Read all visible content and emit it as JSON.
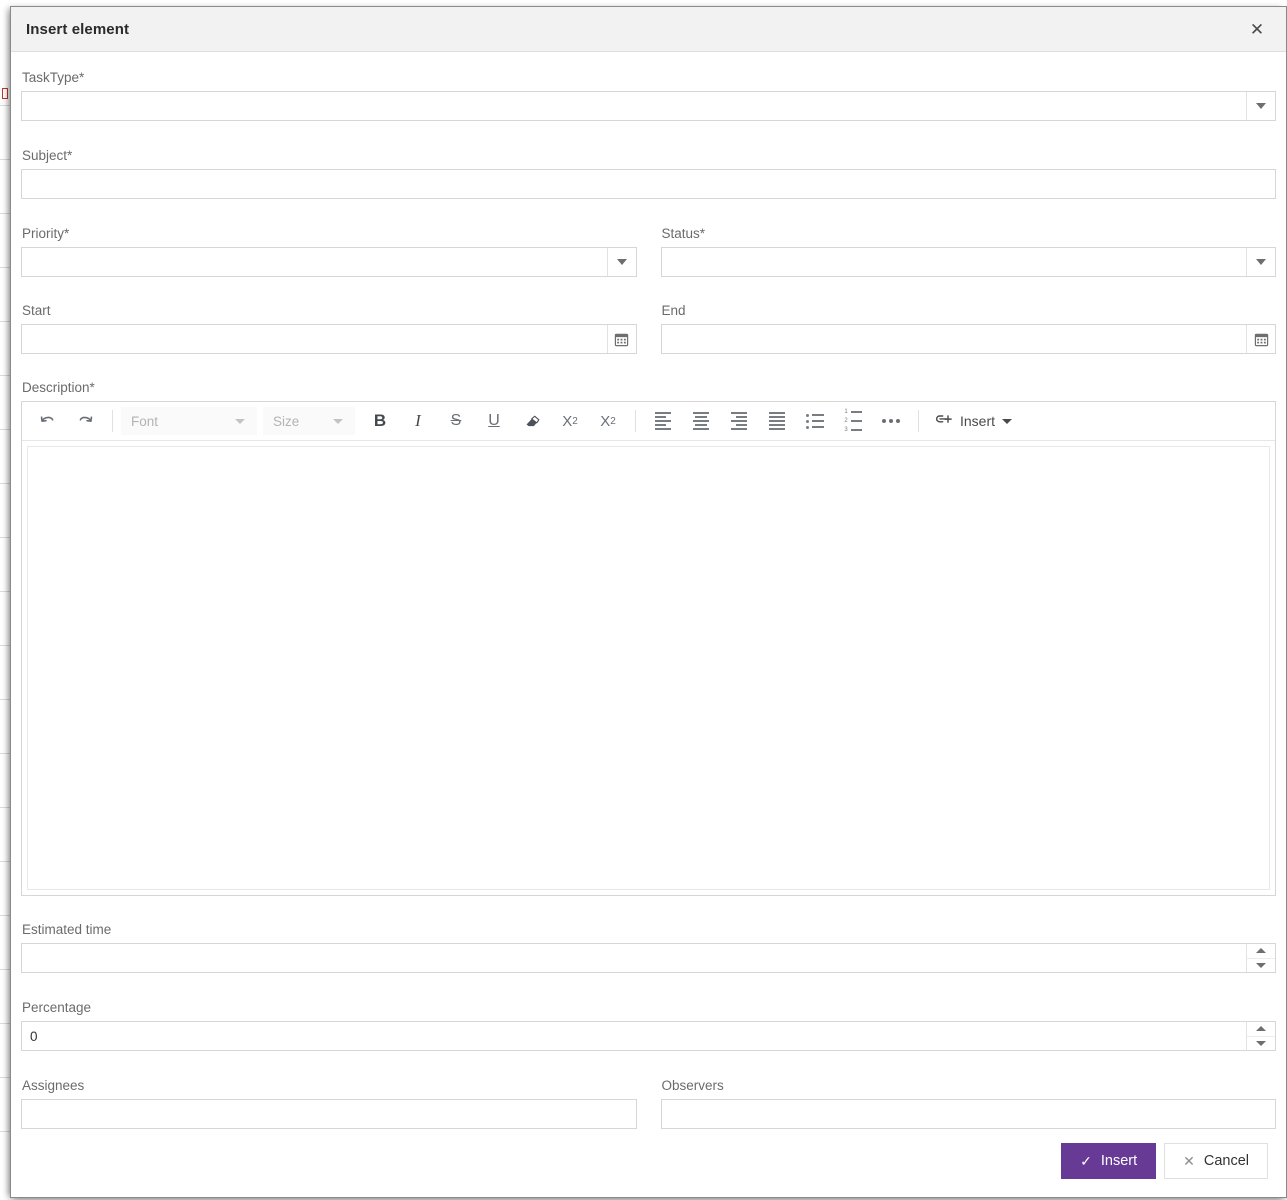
{
  "dialog": {
    "title": "Insert element",
    "close_icon": "close-icon"
  },
  "form": {
    "tasktype": {
      "label": "TaskType*",
      "value": "",
      "placeholder": "",
      "control": "dropdown"
    },
    "subject": {
      "label": "Subject*",
      "value": "",
      "placeholder": "",
      "control": "text"
    },
    "priority": {
      "label": "Priority*",
      "value": "",
      "placeholder": "",
      "control": "dropdown"
    },
    "status": {
      "label": "Status*",
      "value": "",
      "placeholder": "",
      "control": "dropdown"
    },
    "start": {
      "label": "Start",
      "value": "",
      "placeholder": "",
      "control": "datepicker"
    },
    "end": {
      "label": "End",
      "value": "",
      "placeholder": "",
      "control": "datepicker"
    },
    "description": {
      "label": "Description*",
      "value": ""
    },
    "estimated_time": {
      "label": "Estimated time",
      "value": "",
      "placeholder": "",
      "control": "numeric"
    },
    "percentage": {
      "label": "Percentage",
      "value": "0",
      "placeholder": "",
      "control": "numeric"
    },
    "assignees": {
      "label": "Assignees",
      "value": "",
      "placeholder": "",
      "control": "text"
    },
    "observers": {
      "label": "Observers",
      "value": "",
      "placeholder": "",
      "control": "text"
    }
  },
  "editor": {
    "undo": "undo-icon",
    "redo": "redo-icon",
    "font_placeholder": "Font",
    "size_placeholder": "Size",
    "bold": "B",
    "italic": "I",
    "strikethrough": "S",
    "underline": "U",
    "clear_format": "eraser-icon",
    "subscript_base": "X",
    "subscript_sub": "2",
    "superscript_base": "X",
    "superscript_sup": "2",
    "align_left": "align-left-icon",
    "align_center": "align-center-icon",
    "align_right": "align-right-icon",
    "align_justify": "align-justify-icon",
    "bullet_list": "bullet-list-icon",
    "numbered_list": "numbered-list-icon",
    "overflow": "more-options-icon",
    "insert_label": "Insert",
    "insert_icon": "insert-link-icon",
    "list_numbers": [
      "1",
      "2",
      "3"
    ]
  },
  "footer": {
    "insert_label": "Insert",
    "insert_icon": "check-icon",
    "cancel_label": "Cancel",
    "cancel_icon": "x-icon"
  },
  "colors": {
    "primary": "#673B95",
    "header_bg": "#f2f2f2",
    "border": "#d6d6d6",
    "label_text": "#6b6b6b"
  }
}
